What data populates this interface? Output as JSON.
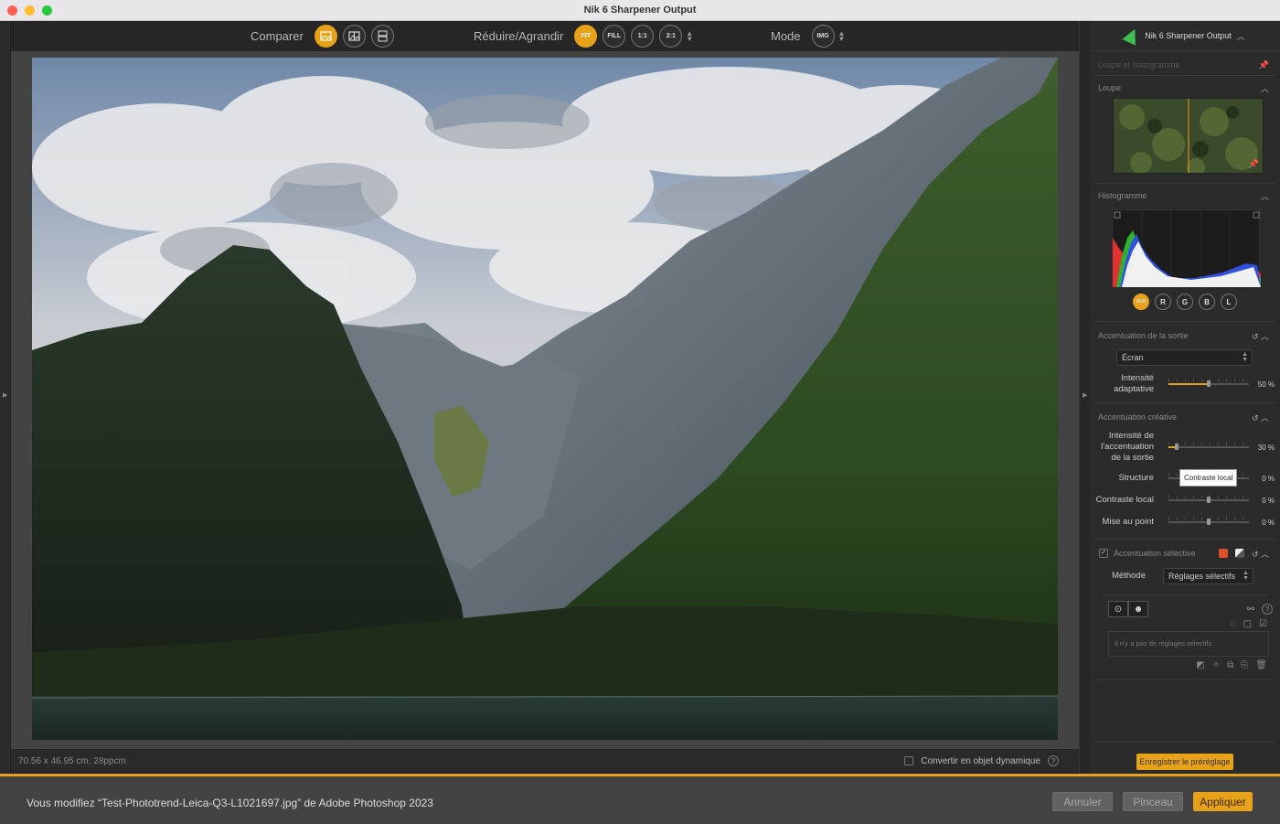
{
  "window": {
    "title": "Nik 6 Sharpener Output"
  },
  "toolbar": {
    "compare_label": "Comparer",
    "zoom_label": "Réduire/Agrandir",
    "zoom_options": [
      "FIT",
      "FILL",
      "1:1",
      "2:1"
    ],
    "zoom_selected": "FIT",
    "mode_label": "Mode",
    "mode_value": "IMG"
  },
  "status": {
    "dimensions": "70.56 x 46.95 cm, 28ppcm",
    "smart_object_label": "Convertir en objet dynamique",
    "help": "?"
  },
  "panel": {
    "title": "Nik 6 Sharpener Output",
    "loupe_group": "Loupe et histogramme",
    "loupe": "Loupe",
    "histogram": "Histogramme",
    "channels": [
      "RGB",
      "R",
      "G",
      "B",
      "L"
    ],
    "output_sharpening": {
      "title": "Accentuation de la sortie",
      "device": "Écran",
      "adaptive_label_1": "Intensité",
      "adaptive_label_2": "adaptative",
      "adaptive_value": "50 %",
      "adaptive_level": 0.5
    },
    "creative_sharpening": {
      "title": "Accentuation créative",
      "strength_label_1": "Intensité de",
      "strength_label_2": "l'accentuation",
      "strength_label_3": "de la sortie",
      "strength_value": "30 %",
      "strength_level": 0.1,
      "structure_label": "Structure",
      "structure_value": "0 %",
      "tooltip": "Contraste local",
      "local_contrast_label": "Contraste local",
      "local_contrast_value": "0 %",
      "focus_label": "Mise au point",
      "focus_value": "0 %"
    },
    "selective": {
      "title": "Accentuation sélective",
      "method_label": "Méthode",
      "method_value": "Réglages sélectifs",
      "empty_text": "Il n'y a pas de réglages sélectifs"
    },
    "save_preset": "Enregistrer le préréglage"
  },
  "footer": {
    "message": "Vous modifiez “Test-Phototrend-Leica-Q3-L1021697.jpg” de Adobe Photoshop 2023",
    "cancel": "Annuler",
    "brush": "Pinceau",
    "apply": "Appliquer"
  },
  "colors": {
    "accent": "#e8a21a",
    "background": "#2b2b2b"
  }
}
